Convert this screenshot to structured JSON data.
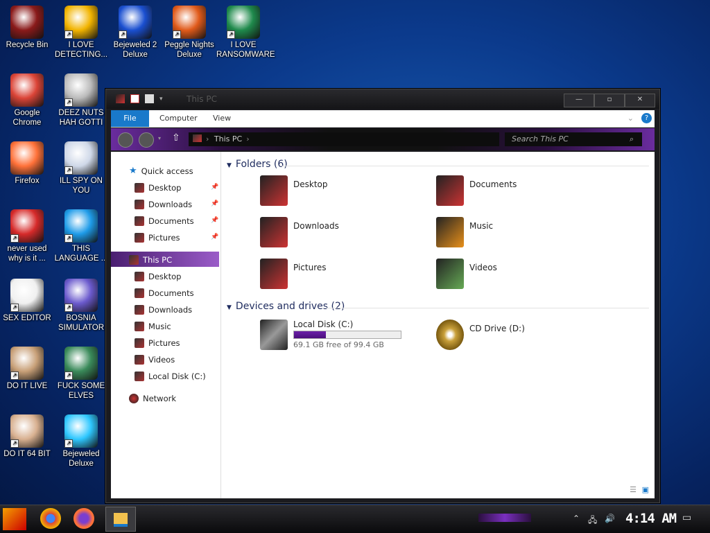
{
  "desktop": {
    "icons": [
      {
        "label": "Recycle Bin",
        "icon": "recycle-bin-icon",
        "color": "#8a1a1a"
      },
      {
        "label": "I LOVE DETECTING...",
        "icon": "detect-it-easy-icon",
        "color": "#f2b400"
      },
      {
        "label": "Bejeweled 2 Deluxe",
        "icon": "bejeweled-2-icon",
        "color": "#1a4fd0"
      },
      {
        "label": "Peggle Nights Deluxe",
        "icon": "peggle-icon",
        "color": "#e05a1a"
      },
      {
        "label": "I LOVE RANSOMWARE",
        "icon": "publisher-icon",
        "color": "#1f8a4c"
      },
      {
        "label": "Google Chrome",
        "icon": "chrome-icon",
        "color": "#db4437"
      },
      {
        "label": "DEEZ NUTS HAH GOTTI",
        "icon": "copy-icon",
        "color": "#bbbbbb"
      },
      {
        "label": "Firefox",
        "icon": "firefox-icon",
        "color": "#ff7139"
      },
      {
        "label": "ILL SPY ON YOU",
        "icon": "spy-icon",
        "color": "#cfd8e8"
      },
      {
        "label": "never used why is it ...",
        "icon": "dev-cpp-icon",
        "color": "#d62a2a"
      },
      {
        "label": "THIS LANGUAGE ...",
        "icon": "goland-icon",
        "color": "#1e9be8"
      },
      {
        "label": "SEX EDITOR",
        "icon": "hxd-icon",
        "color": "#f0f0f0"
      },
      {
        "label": "BOSNIA SIMULATOR",
        "icon": "mine-icon",
        "color": "#6b5acd"
      },
      {
        "label": "DO IT LIVE",
        "icon": "portrait-icon",
        "color": "#c8a078"
      },
      {
        "label": "FUCK SOME ELVES",
        "icon": "elf-icon",
        "color": "#3a8a5a"
      },
      {
        "label": "DO IT 64 BIT",
        "icon": "portrait-64-icon",
        "color": "#d8b090"
      },
      {
        "label": "Bejeweled Deluxe",
        "icon": "diamond-icon",
        "color": "#2ec7ff"
      }
    ]
  },
  "window": {
    "title": "This PC",
    "ribbon": {
      "tabs": [
        "File",
        "Computer",
        "View"
      ],
      "help": "?"
    },
    "address": {
      "path": "This PC",
      "search_placeholder": "Search This PC"
    },
    "nav": {
      "quick_access": "Quick access",
      "quick_items": [
        "Desktop",
        "Downloads",
        "Documents",
        "Pictures"
      ],
      "this_pc": "This PC",
      "pc_items": [
        "Desktop",
        "Documents",
        "Downloads",
        "Music",
        "Pictures",
        "Videos",
        "Local Disk (C:)"
      ],
      "network": "Network"
    },
    "content": {
      "folders_header": "Folders (6)",
      "folders": [
        "Desktop",
        "Documents",
        "Downloads",
        "Music",
        "Pictures",
        "Videos"
      ],
      "devices_header": "Devices and drives (2)",
      "local_disk": {
        "name": "Local Disk (C:)",
        "free_text": "69.1 GB free of 99.4 GB",
        "used_fraction": 0.3
      },
      "cd_drive": {
        "name": "CD Drive (D:)"
      }
    }
  },
  "taskbar": {
    "time": "4:14 AM",
    "accent": "#7a2fbf"
  }
}
